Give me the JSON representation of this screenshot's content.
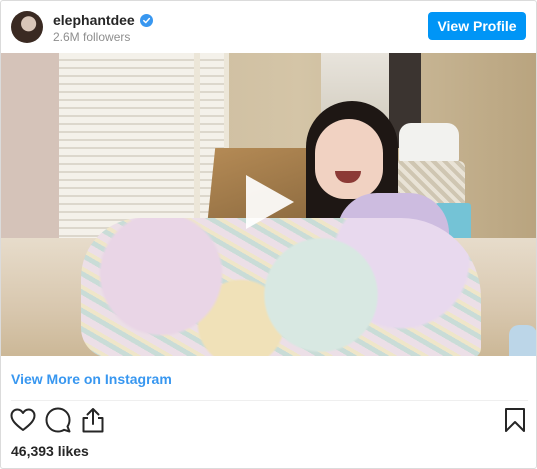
{
  "header": {
    "username": "elephantdee",
    "followers": "2.6M followers",
    "view_profile_label": "View Profile",
    "avatar_icon": "profile-avatar",
    "verified_icon": "verified-badge-icon"
  },
  "media": {
    "type": "video",
    "play_icon": "play-icon"
  },
  "footer": {
    "view_more_label": "View More on Instagram",
    "likes": "46,393 likes",
    "actions": [
      "heart-icon",
      "comment-icon",
      "share-icon",
      "bookmark-icon"
    ]
  },
  "colors": {
    "accent": "#0095f6",
    "link": "#3897f0",
    "text": "#262626",
    "muted": "#8e8e8e"
  }
}
